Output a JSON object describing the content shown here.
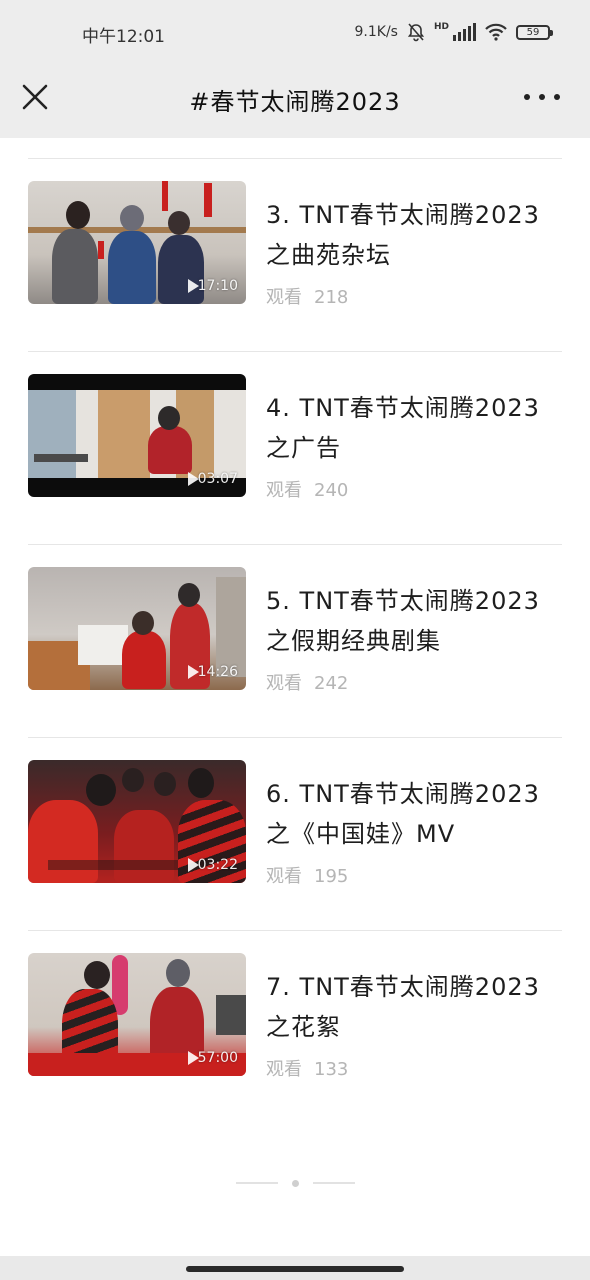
{
  "status": {
    "time": "中午12:01",
    "speed": "9.1K/s",
    "network_tag": "HD",
    "battery": "59"
  },
  "nav": {
    "title": "#春节太闹腾2023",
    "close_icon": "close-icon",
    "more_icon": "more-dots-icon"
  },
  "videos": [
    {
      "title": "3. TNT春节太闹腾2023之曲苑杂坛",
      "views_label": "观看",
      "views": "218",
      "duration": "17:10"
    },
    {
      "title": "4. TNT春节太闹腾2023之广告",
      "views_label": "观看",
      "views": "240",
      "duration": "03:07"
    },
    {
      "title": "5. TNT春节太闹腾2023之假期经典剧集",
      "views_label": "观看",
      "views": "242",
      "duration": "14:26"
    },
    {
      "title": "6. TNT春节太闹腾2023之《中国娃》MV",
      "views_label": "观看",
      "views": "195",
      "duration": "03:22"
    },
    {
      "title": "7. TNT春节太闹腾2023之花絮",
      "views_label": "观看",
      "views": "133",
      "duration": "57:00"
    }
  ],
  "colors": {
    "header_bg": "#ededed",
    "views_gray": "#b5b5b5",
    "accent_red": "#c8201e"
  }
}
